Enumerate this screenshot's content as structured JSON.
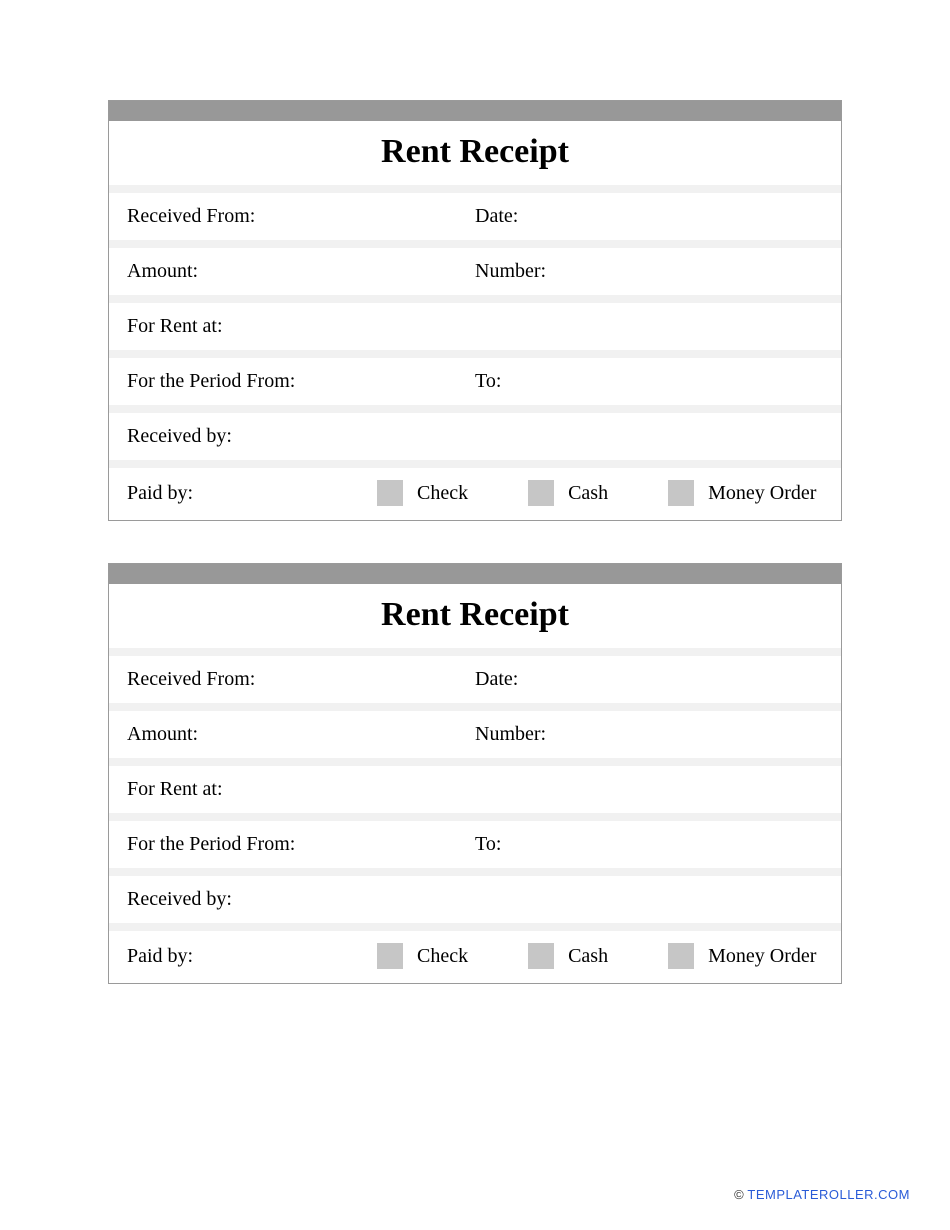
{
  "receipts": [
    {
      "title": "Rent Receipt",
      "received_from_label": "Received From:",
      "date_label": "Date:",
      "amount_label": "Amount:",
      "number_label": "Number:",
      "for_rent_at_label": "For Rent at:",
      "period_from_label": "For the Period From:",
      "period_to_label": "To:",
      "received_by_label": "Received by:",
      "paid_by_label": "Paid by:",
      "options": {
        "check": "Check",
        "cash": "Cash",
        "money_order": "Money Order"
      }
    },
    {
      "title": "Rent Receipt",
      "received_from_label": "Received From:",
      "date_label": "Date:",
      "amount_label": "Amount:",
      "number_label": "Number:",
      "for_rent_at_label": "For Rent at:",
      "period_from_label": "For the Period From:",
      "period_to_label": "To:",
      "received_by_label": "Received by:",
      "paid_by_label": "Paid by:",
      "options": {
        "check": "Check",
        "cash": "Cash",
        "money_order": "Money Order"
      }
    }
  ],
  "footer": {
    "copyright": "©",
    "link_text": "TEMPLATEROLLER.COM"
  }
}
